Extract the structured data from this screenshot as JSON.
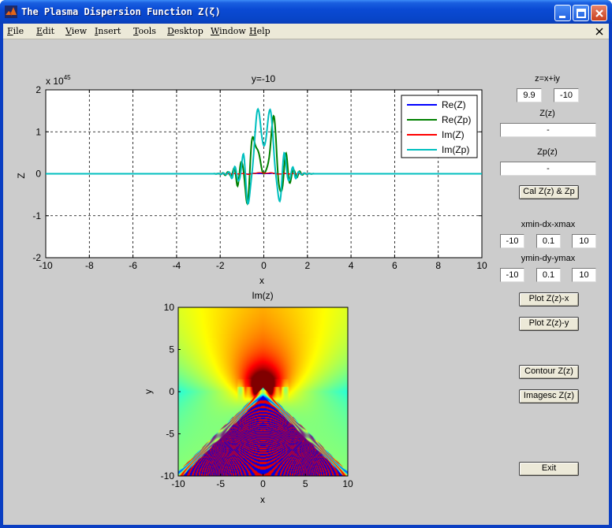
{
  "window": {
    "title": "The Plasma Dispersion Function Z(ζ)"
  },
  "menu": [
    {
      "key": "F",
      "rest": "ile"
    },
    {
      "key": "E",
      "rest": "dit"
    },
    {
      "key": "V",
      "rest": "iew"
    },
    {
      "key": "I",
      "rest": "nsert"
    },
    {
      "key": "T",
      "rest": "ools"
    },
    {
      "key": "D",
      "rest": "esktop"
    },
    {
      "key": "W",
      "rest": "indow"
    },
    {
      "key": "H",
      "rest": "elp"
    }
  ],
  "controls": {
    "z_label": "z=x+iy",
    "x_value": "9.9",
    "y_value": "-10",
    "Z_label": "Z(z)",
    "Z_value": "-",
    "Zp_label": "Zp(z)",
    "Zp_value": "-",
    "calc_button": "Cal Z(z) & Zp",
    "x_range_label": "xmin-dx-xmax",
    "xmin": "-10",
    "dx": "0.1",
    "xmax": "10",
    "y_range_label": "ymin-dy-ymax",
    "ymin": "-10",
    "dy": "0.1",
    "ymax": "10",
    "plot_x_button": "Plot Z(z)-x",
    "plot_y_button": "Plot Z(z)-y",
    "contour_button": "Contour Z(z)",
    "imagesc_button": "Imagesc Z(z)",
    "exit_button": "Exit"
  },
  "chart_data": [
    {
      "type": "line",
      "title": "y=-10",
      "xlabel": "x",
      "ylabel": "Z",
      "exponent_label": "x 10",
      "exponent_power": "45",
      "xlim": [
        -10,
        10
      ],
      "ylim": [
        -2,
        2
      ],
      "xticks": [
        "-10",
        "-8",
        "-6",
        "-4",
        "-2",
        "0",
        "2",
        "4",
        "6",
        "8",
        "10"
      ],
      "yticks": [
        "2",
        "1",
        "0",
        "-1",
        "-2"
      ],
      "grid": true,
      "legend_position": "top-right",
      "series": [
        {
          "name": "Re(Z)",
          "color": "#0000ff",
          "envelope": 0.02
        },
        {
          "name": "Re(Zp)",
          "color": "#008000",
          "envelope": 1.8
        },
        {
          "name": "Im(Z)",
          "color": "#ff0000",
          "envelope": 0.03
        },
        {
          "name": "Im(Zp)",
          "color": "#00bfbf",
          "envelope": 1.7
        }
      ],
      "oscillation_range": [
        -2.3,
        2.3
      ]
    },
    {
      "type": "heatmap",
      "title": "Im(z)",
      "xlabel": "x",
      "ylabel": "y",
      "xlim": [
        -10,
        10
      ],
      "ylim": [
        -10,
        10
      ],
      "xticks": [
        "-10",
        "-5",
        "0",
        "5",
        "10"
      ],
      "yticks": [
        "10",
        "5",
        "0",
        "-5",
        "-10"
      ],
      "colormap": "jet"
    }
  ]
}
